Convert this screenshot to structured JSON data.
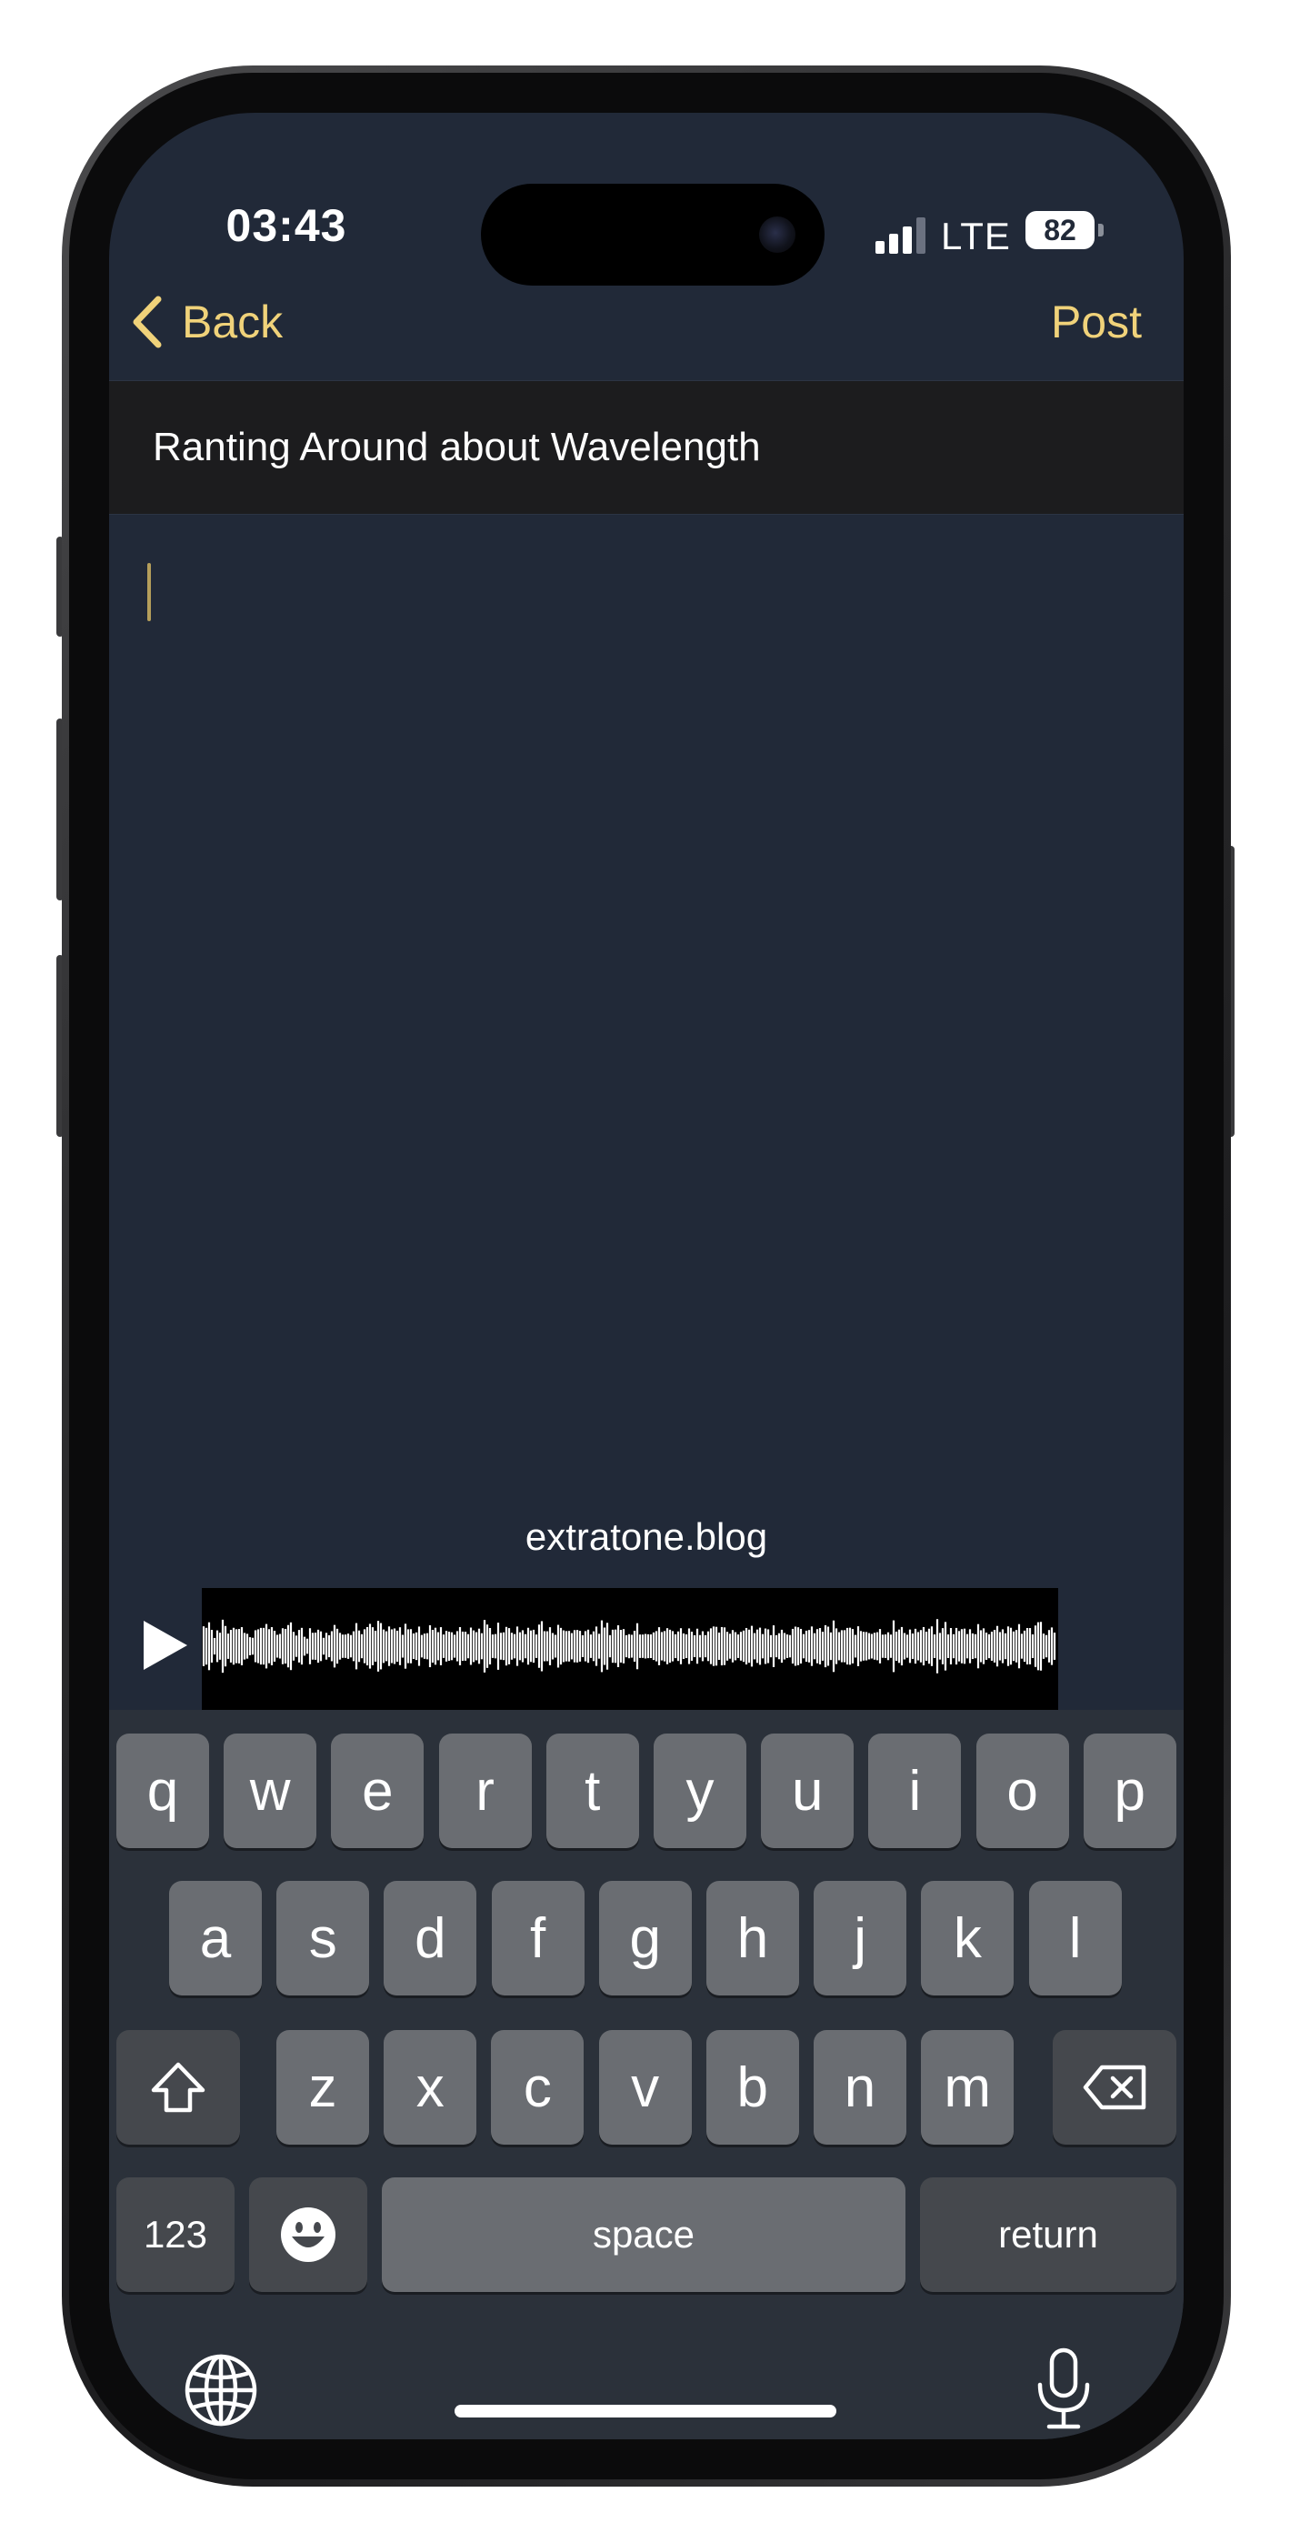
{
  "status_bar": {
    "time": "03:43",
    "network": "LTE",
    "battery": "82"
  },
  "nav": {
    "back_label": "Back",
    "post_label": "Post"
  },
  "editor": {
    "title": "Ranting Around about Wavelength",
    "body": ""
  },
  "audio": {
    "caption": "extratone.blog",
    "icon": "play-icon"
  },
  "keyboard": {
    "row1": [
      "q",
      "w",
      "e",
      "r",
      "t",
      "y",
      "u",
      "i",
      "o",
      "p"
    ],
    "row2": [
      "a",
      "s",
      "d",
      "f",
      "g",
      "h",
      "j",
      "k",
      "l"
    ],
    "row3": [
      "z",
      "x",
      "c",
      "v",
      "b",
      "n",
      "m"
    ],
    "numbers_label": "123",
    "space_label": "space",
    "return_label": "return",
    "icons": {
      "shift": "shift-icon",
      "delete": "backspace-icon",
      "emoji": "emoji-icon",
      "globe": "globe-icon",
      "dictation": "microphone-icon"
    }
  },
  "colors": {
    "accent": "#f0d27a",
    "screen_background": "#212938",
    "title_background": "#1c1c1e",
    "keyboard_background": "#2b313a",
    "key": "#6a6d72",
    "function_key": "#45484d"
  }
}
